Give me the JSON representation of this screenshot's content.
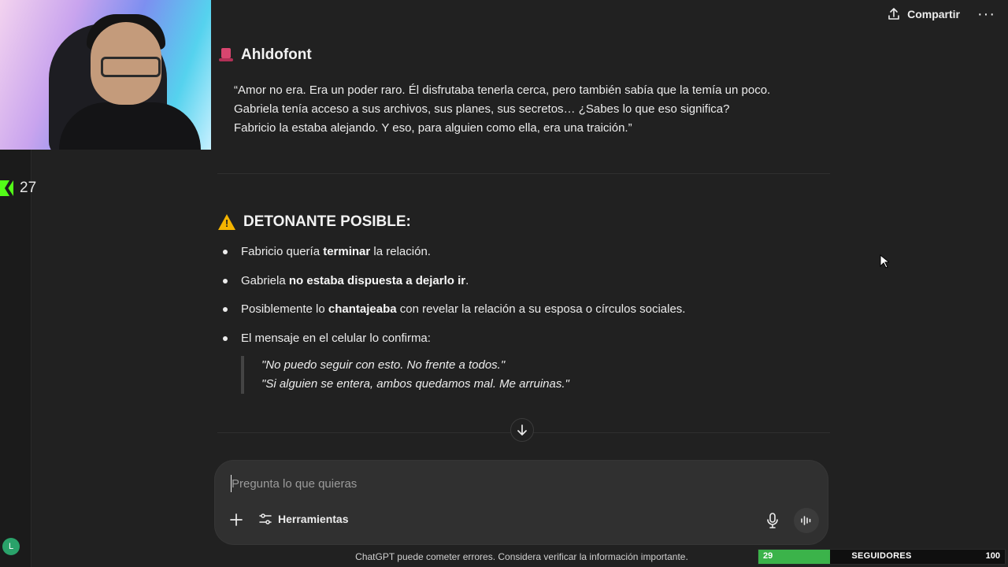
{
  "header": {
    "share_label": "Compartir",
    "more_label": "···"
  },
  "overlay": {
    "stream_counter": "27",
    "avatar_initial": "L",
    "goal": {
      "current": "29",
      "label": "SEGUIDORES",
      "max": "100",
      "fraction": 0.29,
      "fill_color": "#3bb34a"
    }
  },
  "message": {
    "section1_title": "Ahldofont",
    "section1_quote": [
      "“Amor no era. Era un poder raro. Él disfrutaba tenerla cerca, pero también sabía que la temía un poco.",
      "Gabriela tenía acceso a sus archivos, sus planes, sus secretos… ¿Sabes lo que eso significa?",
      "Fabricio la estaba alejando. Y eso, para alguien como ella, era una traición.”"
    ],
    "section2_title": "DETONANTE POSIBLE:",
    "bullets": [
      {
        "pre": "Fabricio quería ",
        "bold": "terminar",
        "post": " la relación."
      },
      {
        "pre": "Gabriela ",
        "bold": "no estaba dispuesta a dejarlo ir",
        "post": "."
      },
      {
        "pre": "Posiblemente lo ",
        "bold": "chantajeaba",
        "post": " con revelar la relación a su esposa o círculos sociales."
      },
      {
        "pre": "El mensaje en el celular lo confirma:",
        "bold": "",
        "post": ""
      }
    ],
    "blockquote": [
      "\"No puedo seguir con esto. No frente a todos.\"",
      "\"Si alguien se entera, ambos quedamos mal. Me arruinas.\""
    ]
  },
  "composer": {
    "placeholder": "Pregunta lo que quieras",
    "tools_label": "Herramientas"
  },
  "footer": {
    "disclaimer": "ChatGPT puede cometer errores. Considera verificar la información importante."
  },
  "colors": {
    "background": "#212121",
    "composer": "#303030",
    "warning": "#f4b400",
    "kick_green": "#53fc18"
  }
}
